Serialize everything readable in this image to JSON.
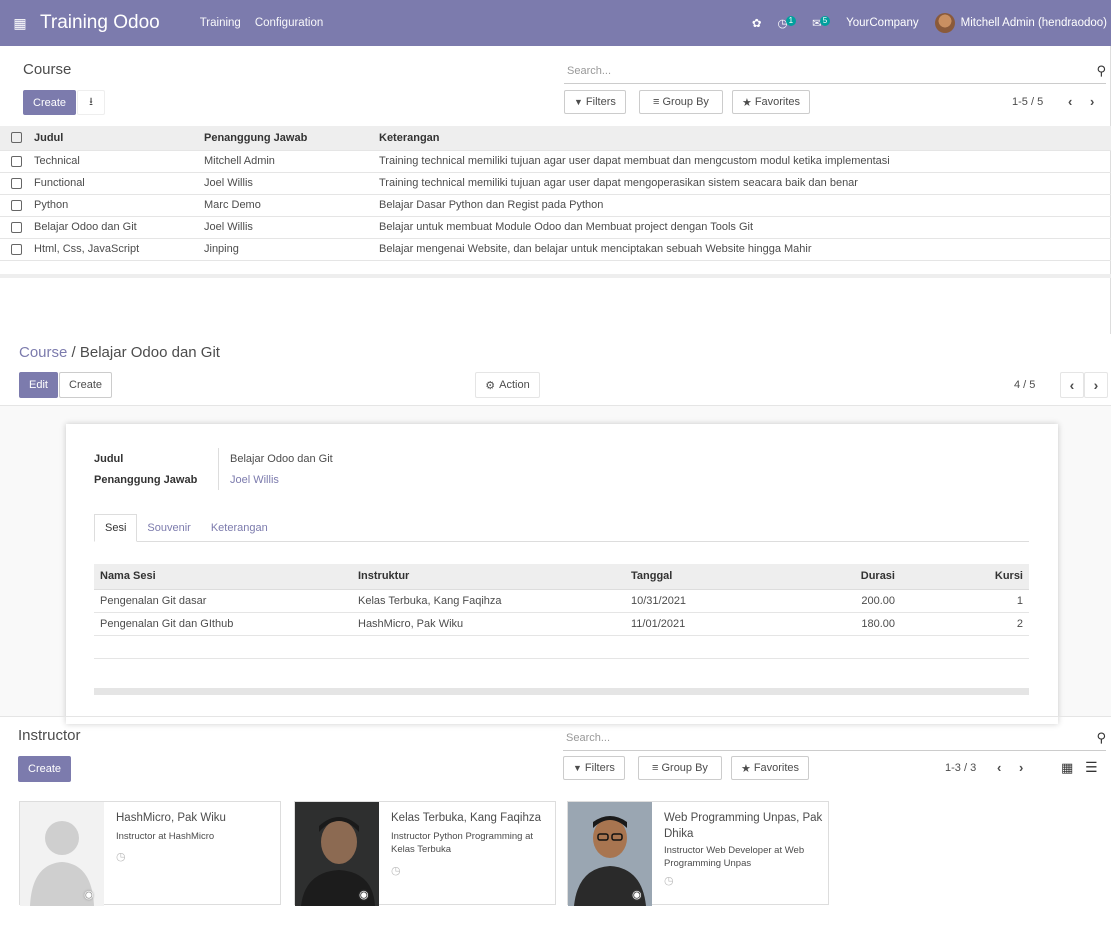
{
  "navbar": {
    "app_name": "Training Odoo",
    "menus": [
      "Training",
      "Configuration"
    ],
    "activity_count": "1",
    "messages_count": "5",
    "company": "YourCompany",
    "user": "Mitchell Admin (hendraodoo)",
    "color": "#7c7bad"
  },
  "course_list": {
    "title": "Course",
    "create_label": "Create",
    "search_placeholder": "Search...",
    "filters_label": "Filters",
    "groupby_label": "Group By",
    "favorites_label": "Favorites",
    "pager": "1-5 / 5",
    "columns": [
      "Judul",
      "Penanggung Jawab",
      "Keterangan"
    ],
    "rows": [
      {
        "judul": "Technical",
        "pj": "Mitchell Admin",
        "ket": "Training technical memiliki tujuan agar user dapat membuat dan mengcustom modul ketika implementasi"
      },
      {
        "judul": "Functional",
        "pj": "Joel Willis",
        "ket": "Training technical memiliki tujuan agar user dapat mengoperasikan sistem seacara baik dan benar"
      },
      {
        "judul": "Python",
        "pj": "Marc Demo",
        "ket": "Belajar Dasar Python dan Regist pada Python"
      },
      {
        "judul": "Belajar Odoo dan Git",
        "pj": "Joel Willis",
        "ket": "Belajar untuk membuat Module Odoo dan Membuat project dengan Tools Git"
      },
      {
        "judul": "Html, Css, JavaScript",
        "pj": "Jinping",
        "ket": "Belajar mengenai Website, dan belajar untuk menciptakan sebuah Website hingga Mahir"
      }
    ]
  },
  "course_form": {
    "breadcrumb_root": "Course",
    "breadcrumb_sep": " / ",
    "breadcrumb_current": "Belajar Odoo dan Git",
    "edit_label": "Edit",
    "create_label": "Create",
    "action_label": "Action",
    "pager": "4 / 5",
    "fields": {
      "judul_label": "Judul",
      "judul_value": "Belajar Odoo dan Git",
      "pj_label": "Penanggung Jawab",
      "pj_value": "Joel Willis"
    },
    "tabs": [
      "Sesi",
      "Souvenir",
      "Keterangan"
    ],
    "sesi_columns": [
      "Nama Sesi",
      "Instruktur",
      "Tanggal",
      "Durasi",
      "Kursi"
    ],
    "sesi_rows": [
      {
        "nama": "Pengenalan Git dasar",
        "instruktur": "Kelas Terbuka, Kang Faqihza",
        "tanggal": "10/31/2021",
        "durasi": "200.00",
        "kursi": "1"
      },
      {
        "nama": "Pengenalan Git dan GIthub",
        "instruktur": "HashMicro, Pak Wiku",
        "tanggal": "11/01/2021",
        "durasi": "180.00",
        "kursi": "2"
      }
    ]
  },
  "instructor": {
    "title": "Instructor",
    "create_label": "Create",
    "search_placeholder": "Search...",
    "filters_label": "Filters",
    "groupby_label": "Group By",
    "favorites_label": "Favorites",
    "pager": "1-3 / 3",
    "cards": [
      {
        "name": "HashMicro, Pak Wiku",
        "subtitle": "Instructor at HashMicro"
      },
      {
        "name": "Kelas Terbuka, Kang Faqihza",
        "subtitle": "Instructor Python Programming at Kelas Terbuka"
      },
      {
        "name": "Web Programming Unpas, Pak Dhika",
        "subtitle": "Instructor Web Developer at Web Programming Unpas"
      }
    ]
  }
}
